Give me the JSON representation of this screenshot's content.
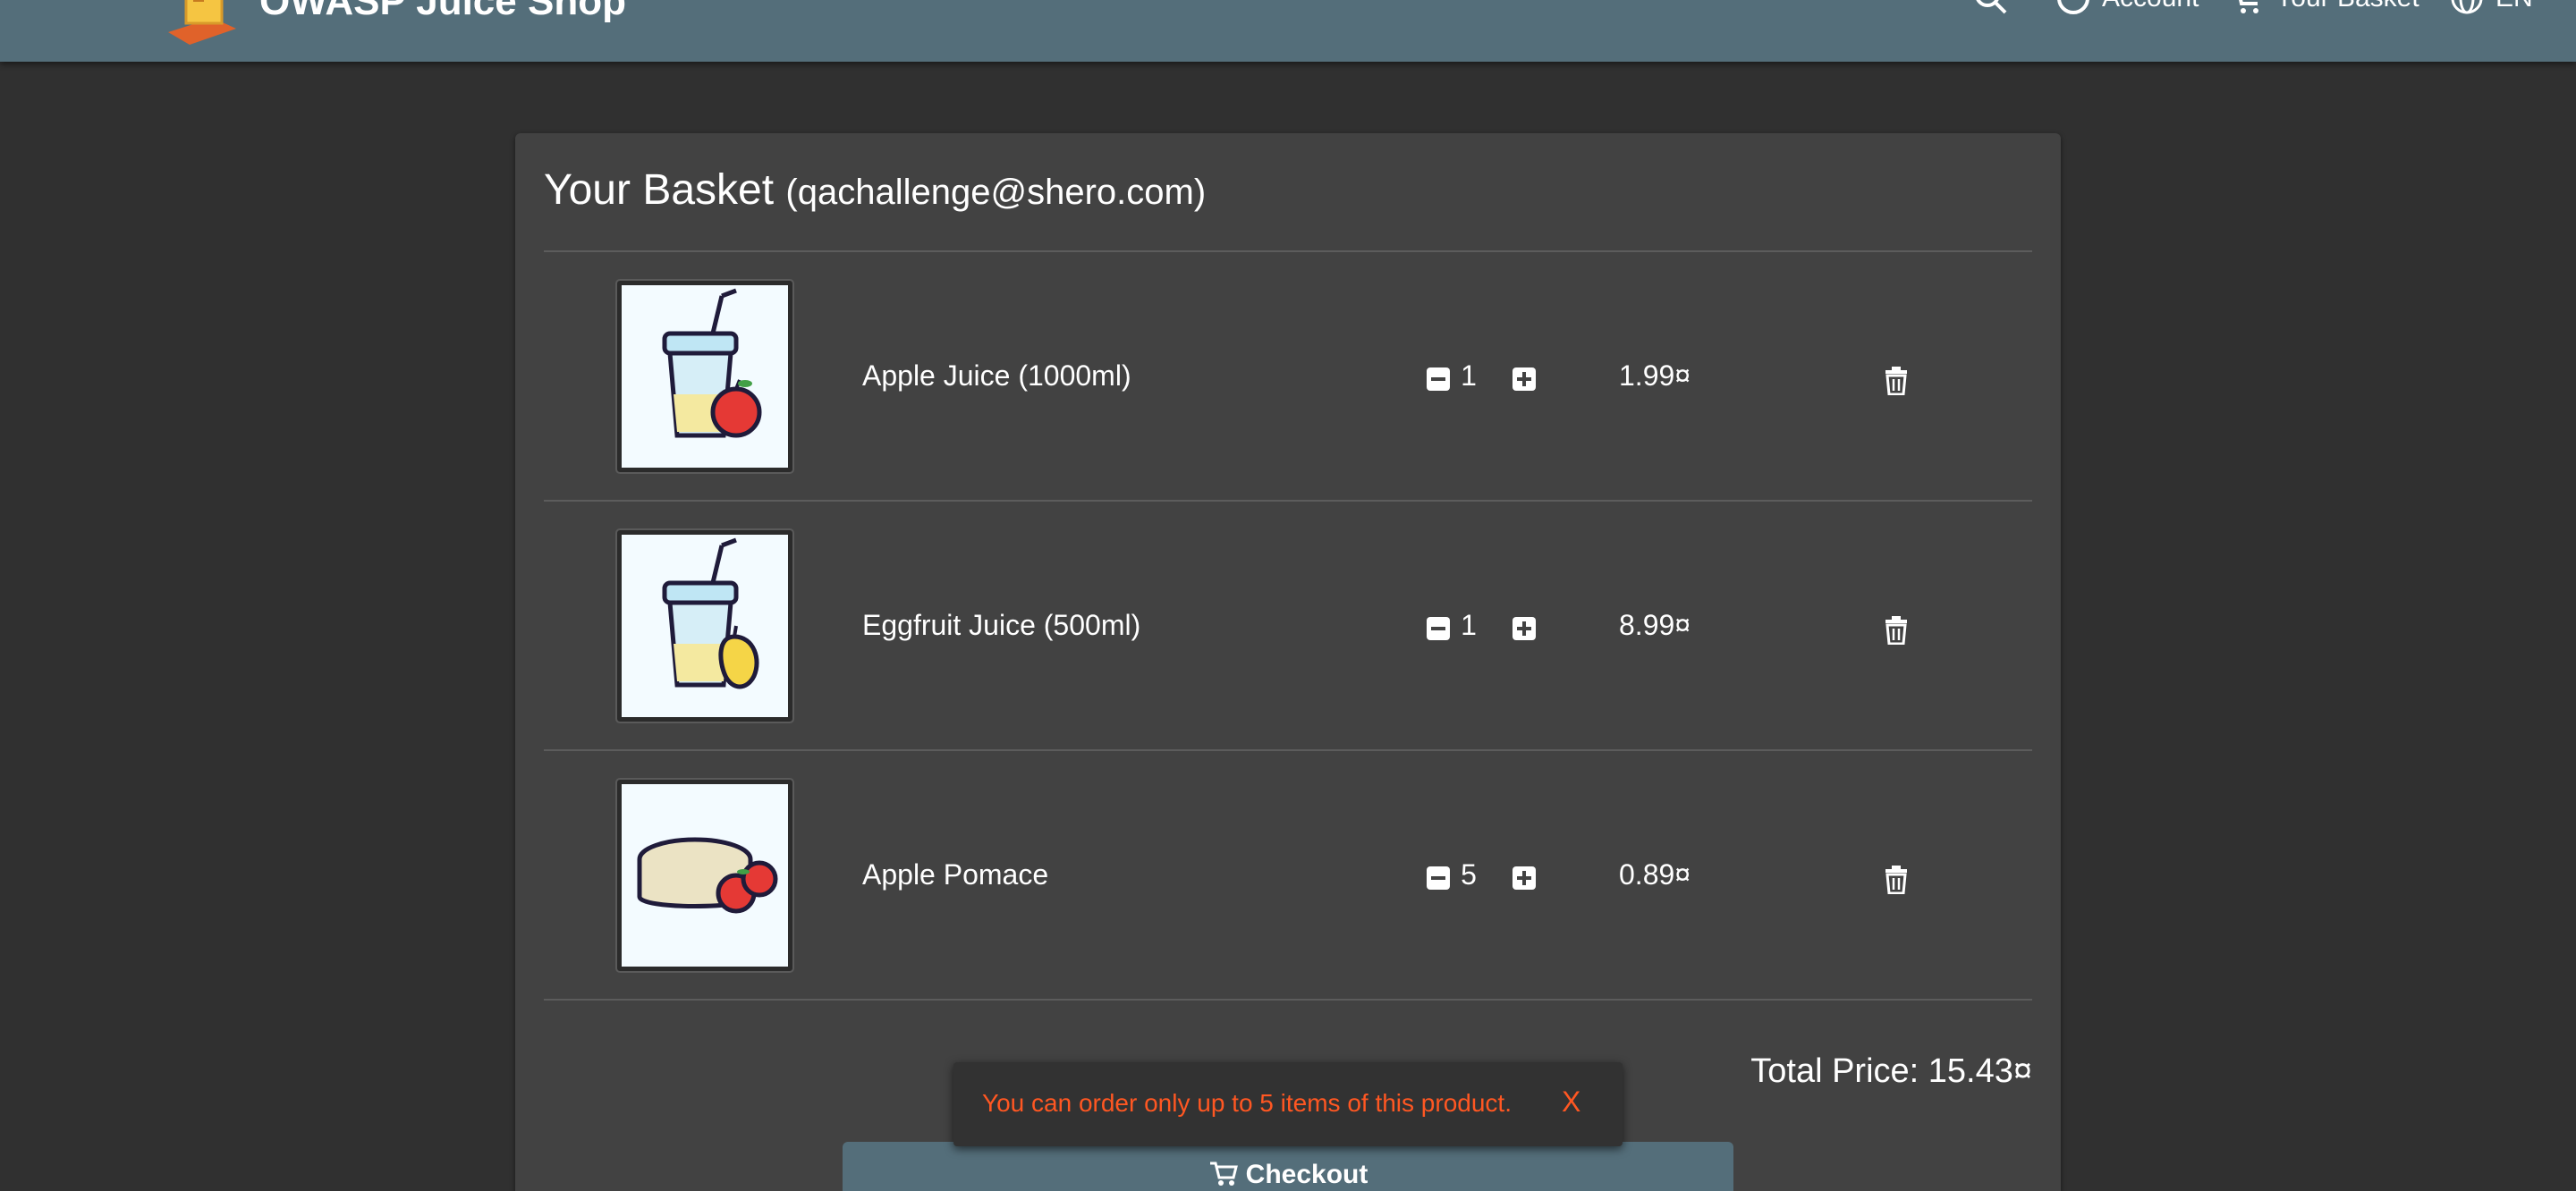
{
  "header": {
    "title": "OWASP Juice Shop",
    "account_label": "Account",
    "basket_label": "Your Basket",
    "language_label": "EN"
  },
  "basket": {
    "heading": "Your Basket",
    "user_email": "(qachallenge@shero.com)",
    "items": [
      {
        "name": "Apple Juice (1000ml)",
        "quantity": "1",
        "price": "1.99¤",
        "image_icon": "apple-juice-icon"
      },
      {
        "name": "Eggfruit Juice (500ml)",
        "quantity": "1",
        "price": "8.99¤",
        "image_icon": "eggfruit-juice-icon"
      },
      {
        "name": "Apple Pomace",
        "quantity": "5",
        "price": "0.89¤",
        "image_icon": "apple-pomace-icon"
      }
    ],
    "total_label": "Total Price: 15.43¤",
    "checkout_label": "Checkout"
  },
  "snackbar": {
    "message": "You can order only up to 5 items of this product.",
    "close_label": "X",
    "color": "#ff5722"
  },
  "colors": {
    "toolbar": "#546e7a",
    "background": "#303030",
    "card": "#424242"
  }
}
